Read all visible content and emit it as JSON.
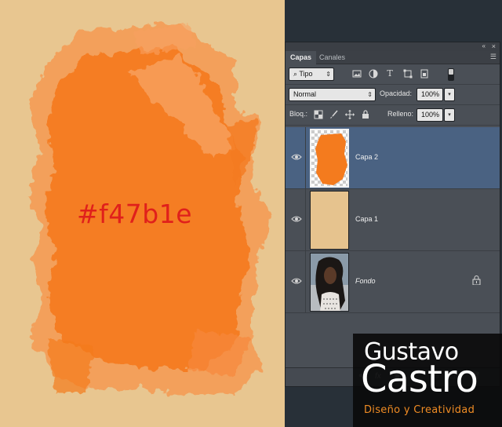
{
  "canvas": {
    "hex_label": "#f47b1e",
    "paint_color": "#f47b1e",
    "background_color": "#e8c690"
  },
  "panel": {
    "tabs": [
      {
        "label": "Capas",
        "active": true
      },
      {
        "label": "Canales",
        "active": false
      }
    ],
    "filter": {
      "kind": "Tipo",
      "icons": [
        "image-filter-icon",
        "adjustment-filter-icon",
        "type-filter-icon",
        "shape-filter-icon",
        "smart-object-filter-icon"
      ]
    },
    "blend_mode": "Normal",
    "opacity_label": "Opacidad:",
    "opacity_value": "100%",
    "lock_label": "Bloq.:",
    "fill_label": "Relleno:",
    "fill_value": "100%",
    "layers": [
      {
        "name": "Capa 2",
        "selected": true,
        "visible": true,
        "locked": false,
        "italic": false
      },
      {
        "name": "Capa 1",
        "selected": false,
        "visible": true,
        "locked": false,
        "italic": false
      },
      {
        "name": "Fondo",
        "selected": false,
        "visible": true,
        "locked": true,
        "italic": true
      }
    ]
  },
  "watermark": {
    "line1": "Gustavo",
    "line2": "Castro",
    "line3": "Diseño y Creatividad",
    "accent_color": "#f08c24"
  }
}
